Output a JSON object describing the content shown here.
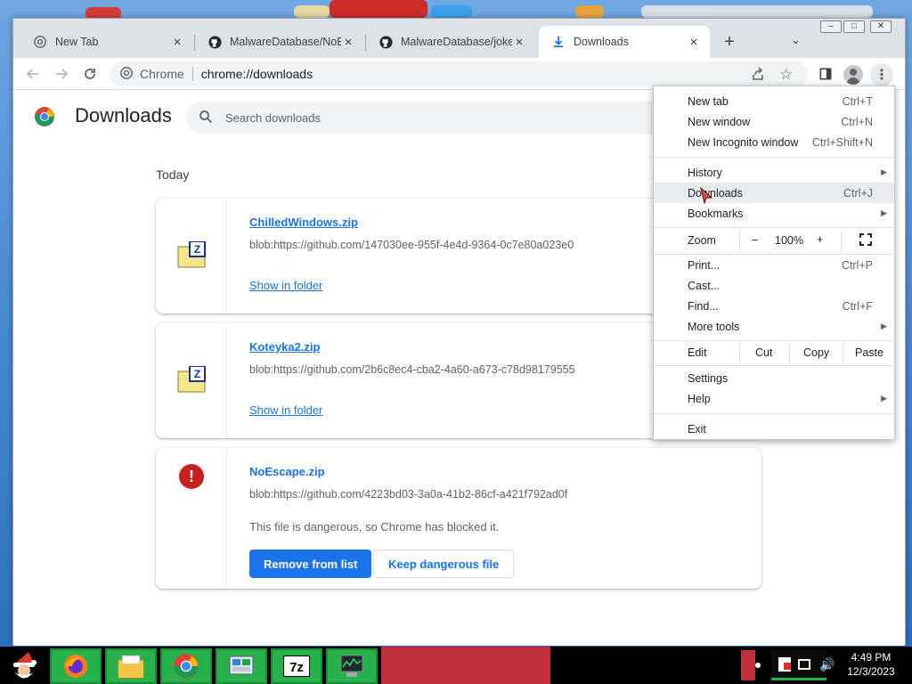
{
  "window": {
    "tabs": [
      {
        "label": "New Tab",
        "icon": "chrome-icon",
        "active": false
      },
      {
        "label": "MalwareDatabase/NoEsc",
        "icon": "github-icon",
        "active": false
      },
      {
        "label": "MalwareDatabase/jokes",
        "icon": "github-icon",
        "active": false
      },
      {
        "label": "Downloads",
        "icon": "download-icon",
        "active": true
      }
    ],
    "controls": {
      "minimize": "–",
      "maximize": "□",
      "close": "✕"
    }
  },
  "toolbar": {
    "site_chip": "Chrome",
    "url": "chrome://downloads"
  },
  "page": {
    "title": "Downloads",
    "search_placeholder": "Search downloads",
    "date_header": "Today",
    "downloads": [
      {
        "name": "ChilledWindows.zip",
        "url": "blob:https://github.com/147030ee-955f-4e4d-9364-0c7e80a023e0",
        "action": "Show in folder"
      },
      {
        "name": "Koteyka2.zip",
        "url": "blob:https://github.com/2b6c8ec4-cba2-4a60-a673-c78d98179555",
        "action": "Show in folder"
      },
      {
        "name": "NoEscape.zip",
        "url": "blob:https://github.com/4223bd03-3a0a-41b2-86cf-a421f792ad0f",
        "message": "This file is dangerous, so Chrome has blocked it.",
        "primary_action": "Remove from list",
        "secondary_action": "Keep dangerous file"
      }
    ]
  },
  "menu": {
    "new_tab": {
      "label": "New tab",
      "shortcut": "Ctrl+T"
    },
    "new_window": {
      "label": "New window",
      "shortcut": "Ctrl+N"
    },
    "new_incognito": {
      "label": "New Incognito window",
      "shortcut": "Ctrl+Shift+N"
    },
    "history": {
      "label": "History"
    },
    "downloads": {
      "label": "Downloads",
      "shortcut": "Ctrl+J"
    },
    "bookmarks": {
      "label": "Bookmarks"
    },
    "zoom": {
      "label": "Zoom",
      "minus": "–",
      "value": "100%",
      "plus": "+"
    },
    "print": {
      "label": "Print...",
      "shortcut": "Ctrl+P"
    },
    "cast": {
      "label": "Cast..."
    },
    "find": {
      "label": "Find...",
      "shortcut": "Ctrl+F"
    },
    "more_tools": {
      "label": "More tools"
    },
    "edit": {
      "label": "Edit",
      "cut": "Cut",
      "copy": "Copy",
      "paste": "Paste"
    },
    "settings": {
      "label": "Settings"
    },
    "help": {
      "label": "Help"
    },
    "exit": {
      "label": "Exit"
    }
  },
  "taskbar": {
    "apps": [
      "firefox-icon",
      "file-manager-icon",
      "chrome-icon",
      "control-panel-icon",
      "7zip-icon",
      "task-manager-icon"
    ],
    "clock_time": "4:49 PM",
    "clock_date": "12/3/2023"
  },
  "colors": {
    "accent": "#1a73e8",
    "danger": "#c5221f",
    "taskbar_green": "#27b14a"
  }
}
